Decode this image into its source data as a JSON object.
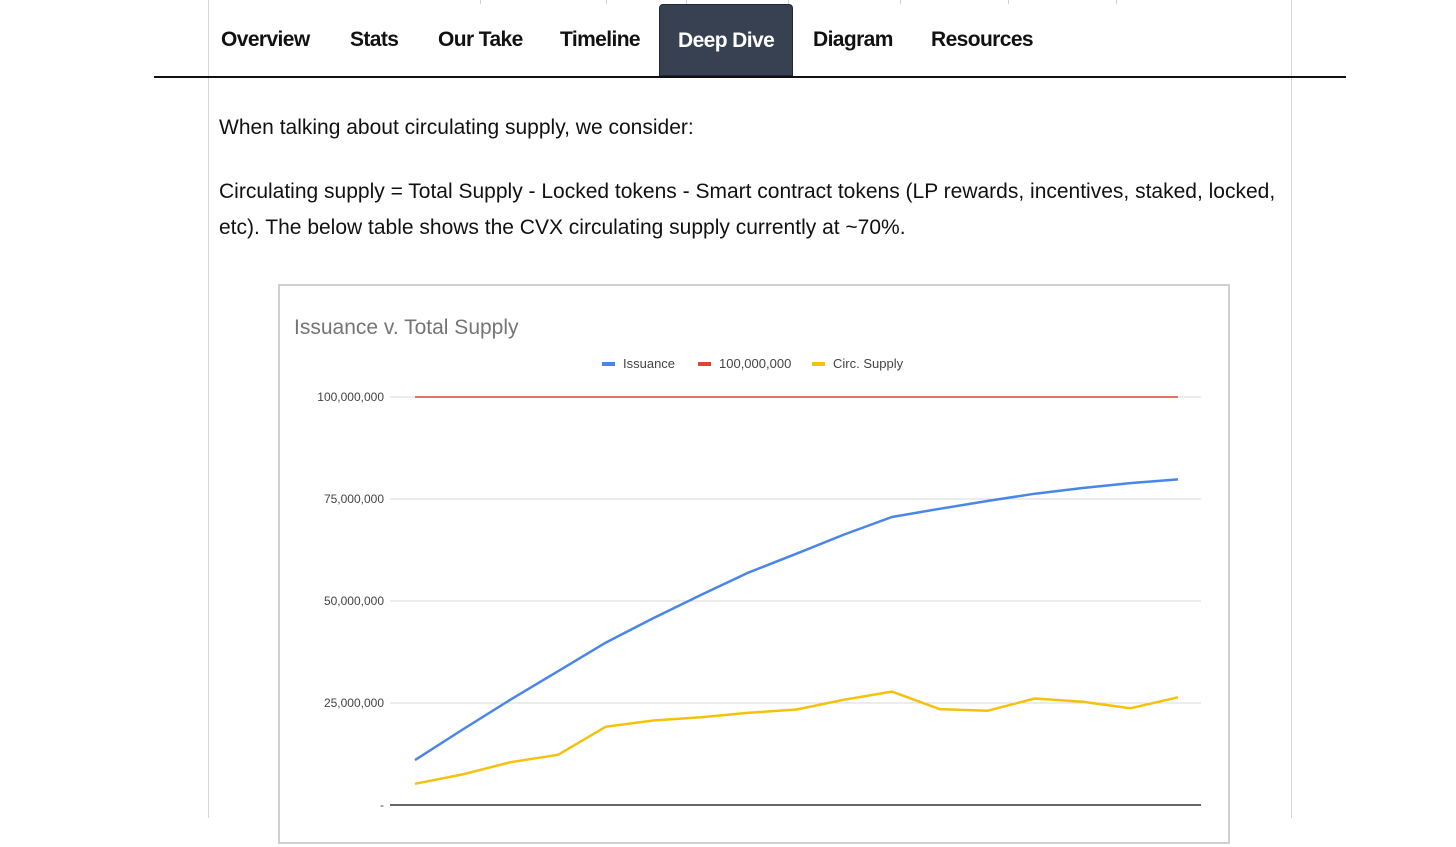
{
  "tabs": [
    {
      "label": "Overview",
      "active": false
    },
    {
      "label": "Stats",
      "active": false
    },
    {
      "label": "Our Take",
      "active": false
    },
    {
      "label": "Timeline",
      "active": false
    },
    {
      "label": "Deep Dive",
      "active": true
    },
    {
      "label": "Diagram",
      "active": false
    },
    {
      "label": "Resources",
      "active": false
    }
  ],
  "content": {
    "intro": "When talking about circulating supply, we consider:",
    "definition": "Circulating supply = Total Supply - Locked tokens - Smart contract tokens (LP rewards, incentives, staked, locked, etc). The below table shows the CVX circulating supply currently at ~70%."
  },
  "chart_data": {
    "type": "line",
    "title": "Issuance v. Total Supply",
    "xlabel": "",
    "ylabel": "",
    "ylim": [
      0,
      100000000
    ],
    "yticks": [
      {
        "value": 0,
        "label": "-"
      },
      {
        "value": 25000000,
        "label": "25,000,000"
      },
      {
        "value": 50000000,
        "label": "50,000,000"
      },
      {
        "value": 75000000,
        "label": "75,000,000"
      },
      {
        "value": 100000000,
        "label": "100,000,000"
      }
    ],
    "grid": true,
    "legend_position": "top",
    "x": [
      1,
      2,
      3,
      4,
      5,
      6,
      7,
      8,
      9,
      10,
      11,
      12,
      13,
      14,
      15,
      16,
      17
    ],
    "series": [
      {
        "name": "Issuance",
        "color": "#4a86e8",
        "values": [
          11000000,
          18500000,
          25800000,
          32800000,
          39800000,
          45800000,
          51500000,
          57000000,
          61600000,
          66300000,
          70600000,
          72600000,
          74500000,
          76300000,
          77700000,
          78900000,
          79800000
        ]
      },
      {
        "name": "100,000,000",
        "color": "#db4437",
        "values": [
          100000000,
          100000000,
          100000000,
          100000000,
          100000000,
          100000000,
          100000000,
          100000000,
          100000000,
          100000000,
          100000000,
          100000000,
          100000000,
          100000000,
          100000000,
          100000000,
          100000000
        ]
      },
      {
        "name": "Circ. Supply",
        "color": "#f4c20d",
        "values": [
          5200000,
          7500000,
          10500000,
          12300000,
          19200000,
          20700000,
          21500000,
          22600000,
          23400000,
          25800000,
          27800000,
          23500000,
          23100000,
          26100000,
          25300000,
          23700000,
          26400000
        ]
      }
    ]
  }
}
